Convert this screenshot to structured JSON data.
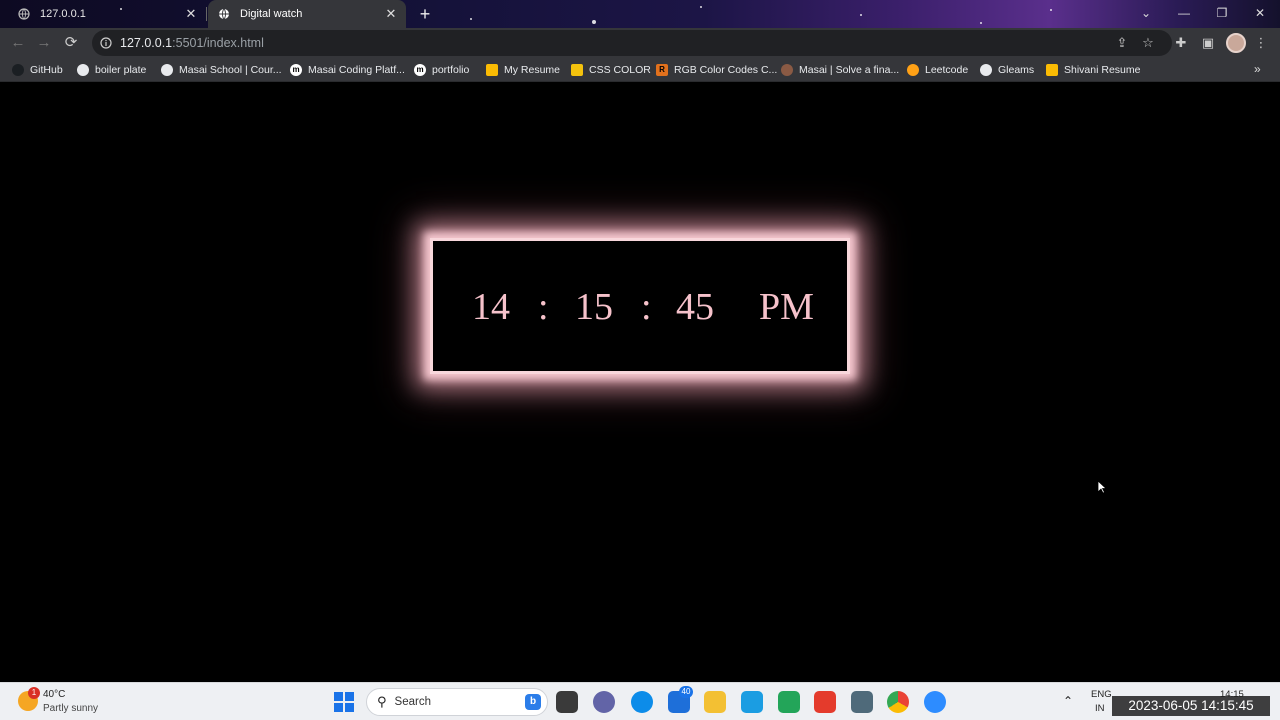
{
  "browser": {
    "tabs": [
      {
        "title": "127.0.0.1",
        "active": false
      },
      {
        "title": "Digital watch",
        "active": true
      }
    ],
    "url_host": "127.0.0.1",
    "url_rest": ":5501/index.html",
    "bookmarks": [
      {
        "label": "GitHub",
        "icon": "github-icon",
        "color": "#1b1f23"
      },
      {
        "label": "boiler plate",
        "icon": "globe-icon",
        "color": "#e8eaed"
      },
      {
        "label": "Masai School | Cour...",
        "icon": "globe-icon",
        "color": "#e8eaed"
      },
      {
        "label": "Masai Coding Platf...",
        "icon": "m-icon",
        "color": "#ffffff"
      },
      {
        "label": "portfolio",
        "icon": "m-icon",
        "color": "#ffffff"
      },
      {
        "label": "My Resume",
        "icon": "drive-icon",
        "color": "#fbbc04"
      },
      {
        "label": "CSS COLOR",
        "icon": "css-icon",
        "color": "#f4c20d"
      },
      {
        "label": "RGB Color Codes C...",
        "icon": "r-icon",
        "color": "#e2711d"
      },
      {
        "label": "Masai | Solve a fina...",
        "icon": "avatar-icon",
        "color": "#8a5a44"
      },
      {
        "label": "Leetcode",
        "icon": "leetcode-icon",
        "color": "#ffa116"
      },
      {
        "label": "Gleams",
        "icon": "globe-icon",
        "color": "#e8eaed"
      },
      {
        "label": "Shivani Resume",
        "icon": "drive-icon",
        "color": "#fbbc04"
      }
    ]
  },
  "clock": {
    "hours": "14",
    "sep1": ":",
    "minutes": "15",
    "sep2": ":",
    "seconds": "45",
    "period": "PM",
    "text_color": "#f6c2cb",
    "glow_color": "#f5c7cf"
  },
  "taskbar": {
    "weather_temp": "40°C",
    "weather_desc": "Partly sunny",
    "weather_badge": "1",
    "search_label": "Search",
    "mail_badge": "40",
    "lang_top": "ENG",
    "lang_bottom": "IN",
    "time": "14:15"
  },
  "overlay_timestamp": "2023-06-05 14:15:45"
}
